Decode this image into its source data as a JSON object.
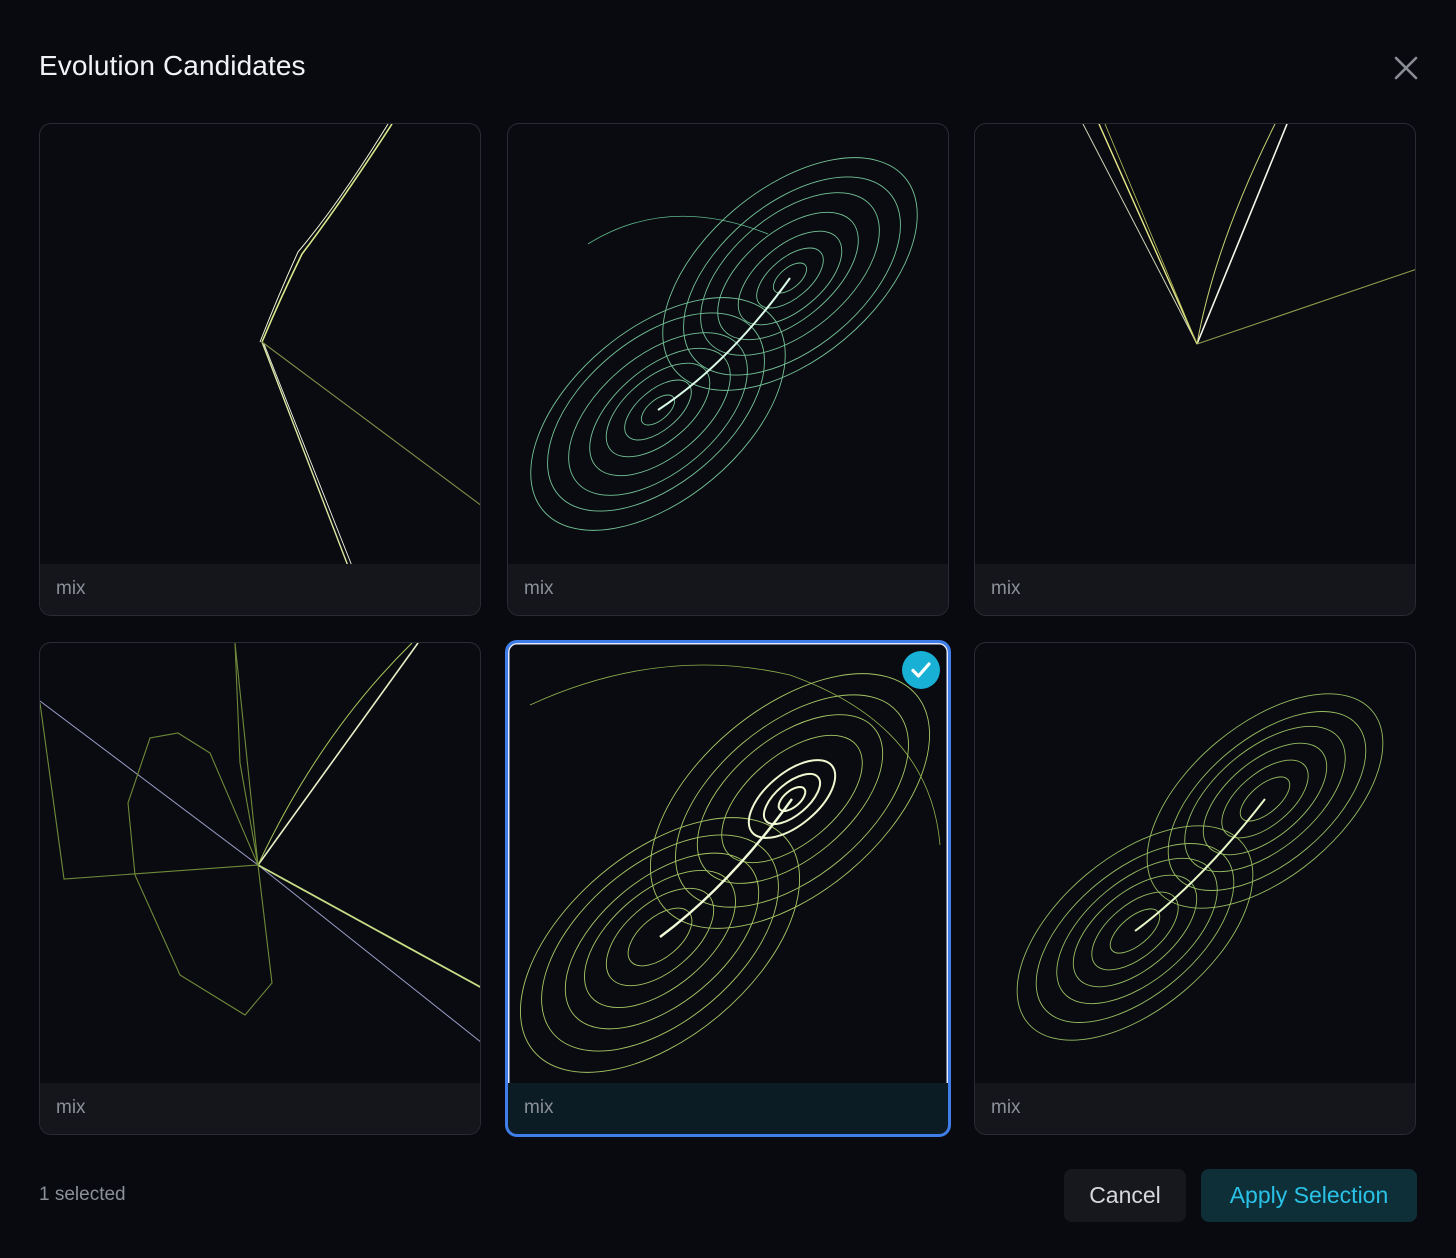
{
  "dialog": {
    "title": "Evolution Candidates",
    "close_icon": "close-icon"
  },
  "candidates": [
    {
      "label": "mix",
      "selected": false
    },
    {
      "label": "mix",
      "selected": false
    },
    {
      "label": "mix",
      "selected": false
    },
    {
      "label": "mix",
      "selected": false
    },
    {
      "label": "mix",
      "selected": true
    },
    {
      "label": "mix",
      "selected": false
    }
  ],
  "footer": {
    "status": "1 selected",
    "cancel_label": "Cancel",
    "apply_label": "Apply Selection"
  },
  "colors": {
    "accent": "#29c2e6",
    "selected_border": "#3f7ee8",
    "check_badge": "#19b0d6"
  }
}
